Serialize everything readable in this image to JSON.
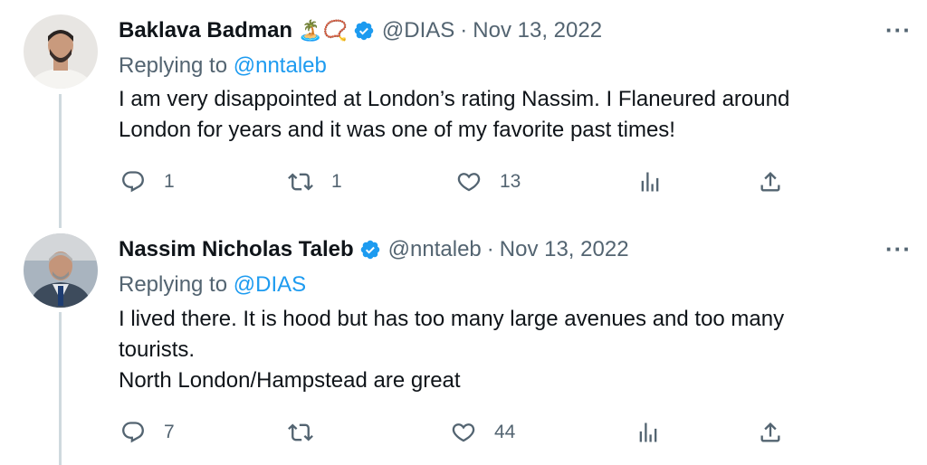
{
  "tweets": [
    {
      "name": "Baklava Badman",
      "emoji": "🏝️📿",
      "handle": "@DIAS",
      "separator": "·",
      "date": "Nov 13, 2022",
      "more": "···",
      "replying_prefix": "Replying to",
      "replying_to": "@nntaleb",
      "text_lines": [
        "I am very disappointed at London’s rating Nassim. I Flaneured around London for years and it was one of my favorite past times!"
      ],
      "replies": "1",
      "retweets": "1",
      "likes": "13"
    },
    {
      "name": "Nassim Nicholas Taleb",
      "handle": "@nntaleb",
      "separator": "·",
      "date": "Nov 13, 2022",
      "more": "···",
      "replying_prefix": "Replying to",
      "replying_to": "@DIAS",
      "text_lines": [
        "I lived there. It is hood but has too many large avenues and too many tourists.",
        "North London/Hampstead are great"
      ],
      "replies": "7",
      "retweets": "",
      "likes": "44"
    }
  ],
  "colors": {
    "accent": "#1d9bf0",
    "muted": "#536471",
    "text": "#0f1419",
    "thread": "#cfd9de"
  },
  "icons": [
    "reply-icon",
    "retweet-icon",
    "like-icon",
    "views-icon",
    "share-icon",
    "verified-badge-icon"
  ]
}
